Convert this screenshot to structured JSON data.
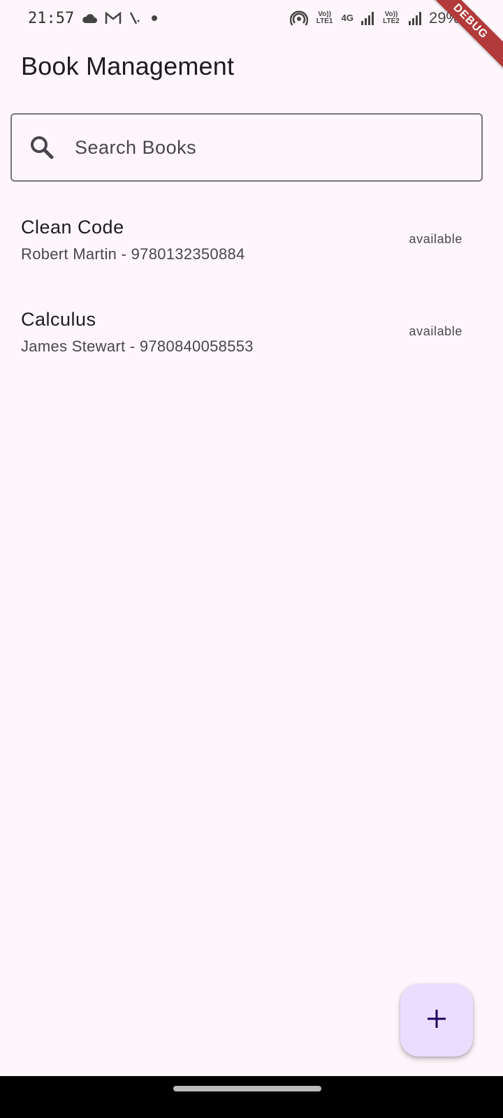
{
  "status_bar": {
    "time": "21:57",
    "battery": "29%",
    "volte1": "Vo)) LTE1",
    "network": "4G",
    "volte2": "Vo)) LTE2",
    "left_icons": [
      "cloud-icon",
      "gmail-icon",
      "wrench-icon",
      "dot-icon"
    ],
    "right_icons": [
      "hotspot-icon",
      "volte1-icon",
      "4g-icon",
      "signal1-icon",
      "volte2-icon",
      "signal2-icon",
      "battery-icon"
    ]
  },
  "debug_banner": "DEBUG",
  "app_bar": {
    "title": "Book Management"
  },
  "search": {
    "placeholder": "Search Books",
    "value": ""
  },
  "books": [
    {
      "title": "Clean Code",
      "author_isbn": "Robert Martin - 9780132350884",
      "status": "available"
    },
    {
      "title": "Calculus",
      "author_isbn": "James Stewart - 9780840058553",
      "status": "available"
    }
  ],
  "fab": {
    "icon": "plus-icon"
  },
  "colors": {
    "background": "#fdf7fc",
    "fab": "#eaddff",
    "debug_banner": "#b33a3a",
    "outline": "#79747e"
  }
}
